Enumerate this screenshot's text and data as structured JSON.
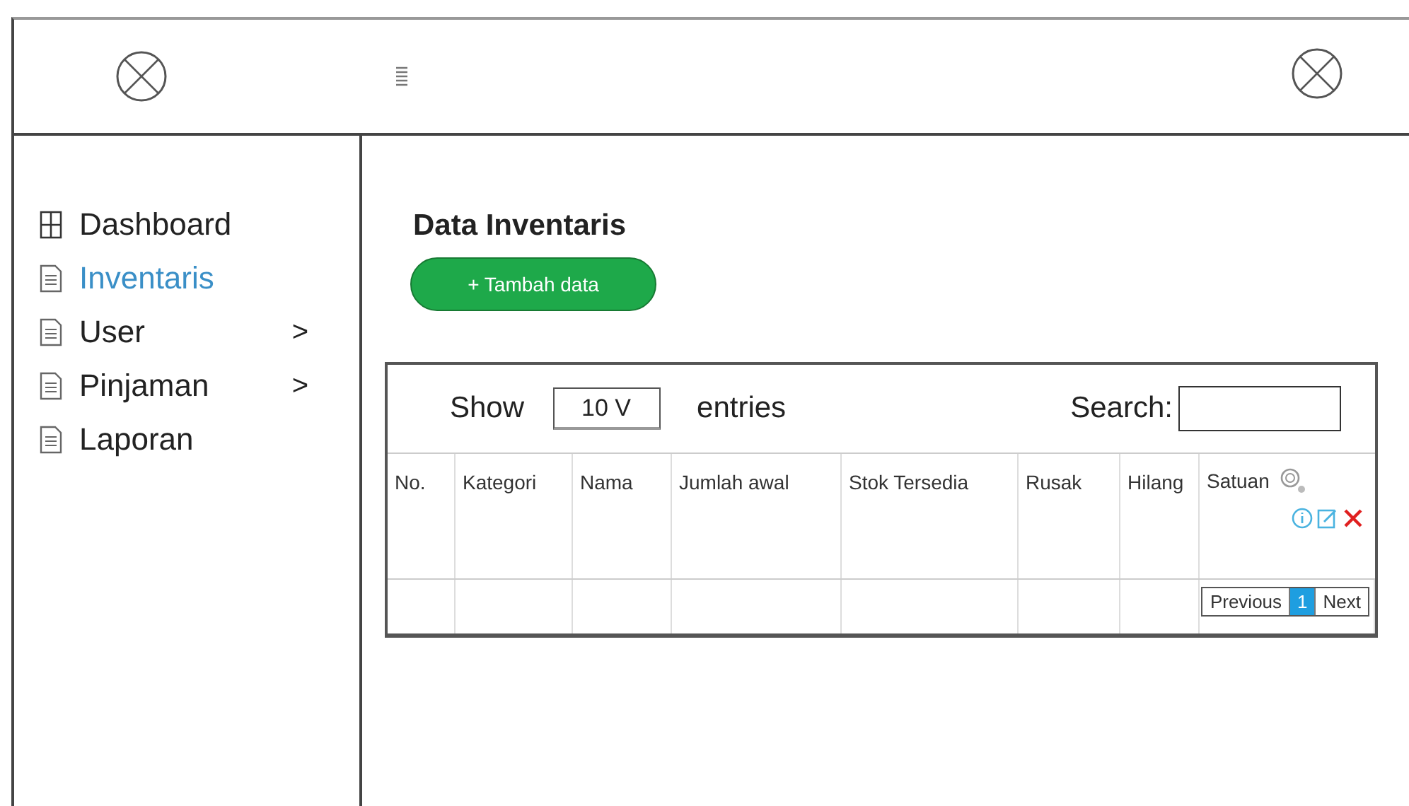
{
  "sidebar": {
    "items": [
      {
        "label": "Dashboard",
        "kind": "grid",
        "selected": false
      },
      {
        "label": "Inventaris",
        "kind": "page",
        "selected": true
      },
      {
        "label": "User",
        "kind": "page",
        "selected": false,
        "arrow": ">"
      },
      {
        "label": "Pinjaman",
        "kind": "page",
        "selected": false,
        "arrow": ">"
      },
      {
        "label": "Laporan",
        "kind": "page",
        "selected": false
      }
    ]
  },
  "page": {
    "title": "Data Inventaris",
    "add_button": "+ Tambah data"
  },
  "table": {
    "show_label": "Show",
    "entries_value": "10 V",
    "entries_label": "entries",
    "search_label": "Search:",
    "columns": [
      "No.",
      "Kategori",
      "Nama",
      "Jumlah awal",
      "Stok Tersedia",
      "Rusak",
      "Hilang",
      "Satuan"
    ],
    "pagination": [
      {
        "label": "Previous",
        "selected": false
      },
      {
        "label": "1",
        "selected": true
      },
      {
        "label": "Next",
        "selected": false
      }
    ]
  }
}
